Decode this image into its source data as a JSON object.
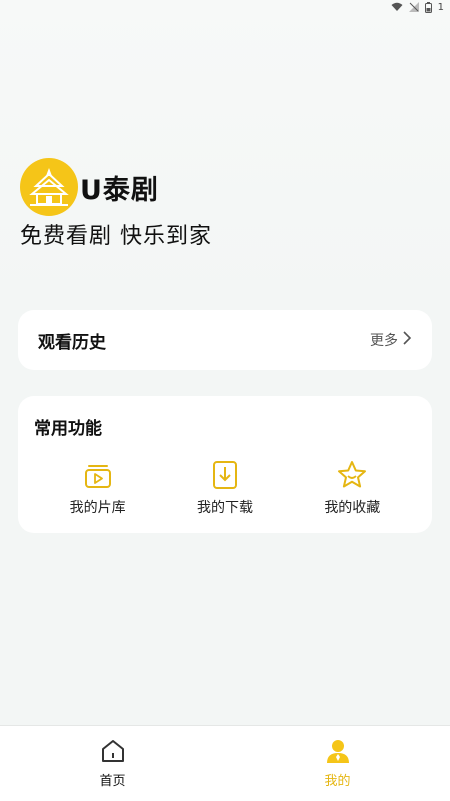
{
  "status_bar": {
    "battery": "1"
  },
  "brand": {
    "name": "U泰剧",
    "slogan": "免费看剧 快乐到家"
  },
  "history": {
    "title": "观看历史",
    "more_label": "更多"
  },
  "features": {
    "title": "常用功能",
    "items": [
      {
        "label": "我的片库",
        "icon": "library-icon"
      },
      {
        "label": "我的下载",
        "icon": "download-icon"
      },
      {
        "label": "我的收藏",
        "icon": "star-icon"
      }
    ]
  },
  "bottom_nav": {
    "items": [
      {
        "label": "首页",
        "icon": "home-icon",
        "active": false
      },
      {
        "label": "我的",
        "icon": "user-icon",
        "active": true
      }
    ]
  },
  "colors": {
    "accent": "#f5c518",
    "accent_text": "#e5b612",
    "background": "#f3f6f5"
  }
}
